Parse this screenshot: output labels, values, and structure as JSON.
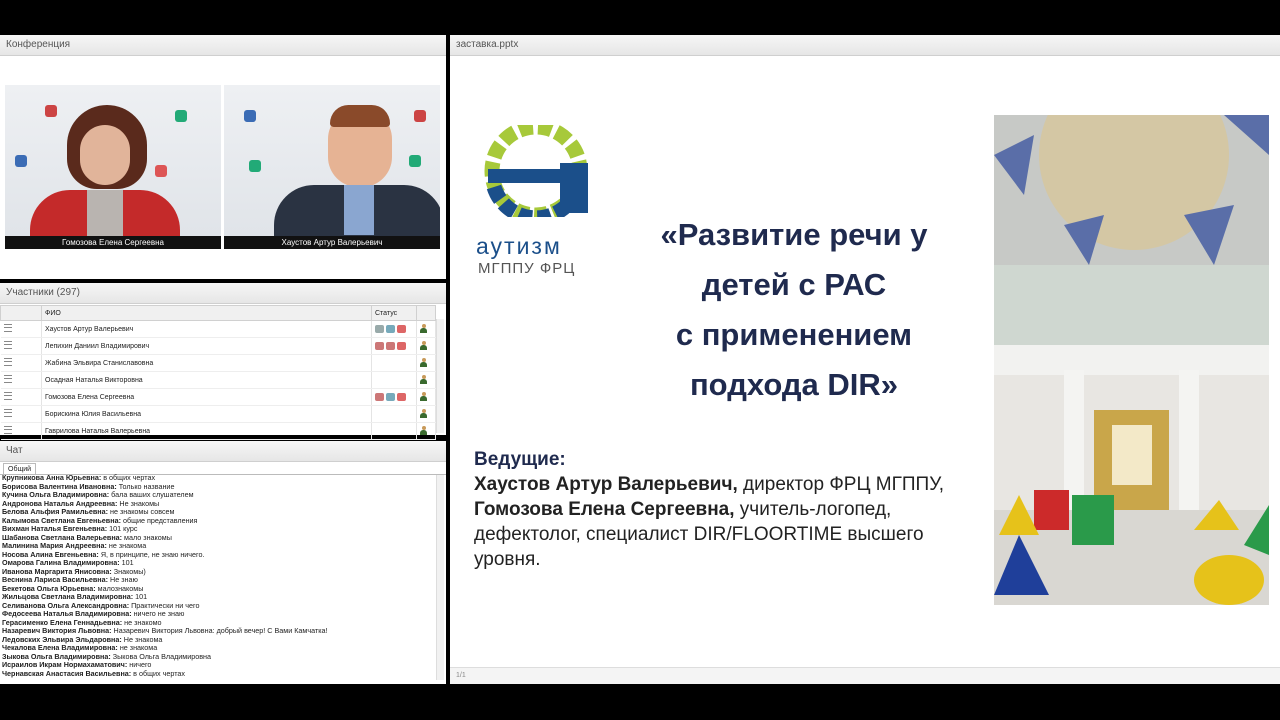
{
  "conference": {
    "title": "Конференция",
    "videos": [
      {
        "name": "Гомозова Елена Сергеевна"
      },
      {
        "name": "Хаустов Артур Валерьевич"
      }
    ]
  },
  "participants": {
    "title": "Участники (297)",
    "headers": {
      "name": "ФИО",
      "status": "Статус"
    },
    "rows": [
      {
        "name": "Хаустов Артур Валерьевич"
      },
      {
        "name": "Лепихин Даниил Владимирович"
      },
      {
        "name": "Жабина Эльвира Станиславовна"
      },
      {
        "name": "Осадная Наталья Викторовна"
      },
      {
        "name": "Гомозова Елена Сергеевна"
      },
      {
        "name": "Борискина Юлия Васильевна"
      },
      {
        "name": "Гаврилова Наталья Валерьевна"
      }
    ]
  },
  "chat": {
    "title": "Чат",
    "tab": "Общий",
    "messages": [
      {
        "author": "Крупникова Анна Юрьевна:",
        "text": " в общих чертах"
      },
      {
        "author": "Борисова Валентина Ивановна:",
        "text": " Только название"
      },
      {
        "author": "Кучина Ольга Владимировна:",
        "text": " бала ваших слушателем"
      },
      {
        "author": "Андронова Наталья Андреевна:",
        "text": " Не знакомы"
      },
      {
        "author": "Белова Альфия Рамильевна:",
        "text": " не знакомы совсем"
      },
      {
        "author": "Калымова Светлана Евгеньевна:",
        "text": " общие представления"
      },
      {
        "author": "Вихман Наталья  Евгеньевна:",
        "text": " 101 курс"
      },
      {
        "author": "Шабанова Светлана Валерьевна:",
        "text": " мало знакомы"
      },
      {
        "author": "Малинина Мария Андреевна:",
        "text": " не знакома"
      },
      {
        "author": "Носова Алина Евгеньевна:",
        "text": " Я, в принципе, не знаю ничего."
      },
      {
        "author": "Омарова Галина Владимировна:",
        "text": " 101"
      },
      {
        "author": "Иванова Маргарита Янисовна:",
        "text": " Знакомы)"
      },
      {
        "author": "Веснина Лариса Васильевна:",
        "text": " Не знаю"
      },
      {
        "author": "Бекетова Ольга Юрьевна:",
        "text": " малознакомы"
      },
      {
        "author": "Жильцова Светлана Владимировна:",
        "text": " 101"
      },
      {
        "author": "Селиванова Ольга Александровна:",
        "text": " Практически ни чего"
      },
      {
        "author": "Федосеева Наталья Владимировна:",
        "text": " ничего не знаю"
      },
      {
        "author": "Герасименко Елена Геннадьевна:",
        "text": " не знакомо"
      },
      {
        "author": "Назаревич Виктория Львовна:",
        "text": " Назаревич Виктория Львовна: добрый вечер! С Вами Камчатка!"
      },
      {
        "author": "Ледовских Эльвира Эльдаровна:",
        "text": " Не знакома"
      },
      {
        "author": "Чекалова Елена Владимировна:",
        "text": " не знакома"
      },
      {
        "author": "Зыкова Ольга Владимировна:",
        "text": " Зыкова Ольга Владимировна"
      },
      {
        "author": "Исраилов Икрам Нормахаматович:",
        "text": " ничего"
      },
      {
        "author": "Чернавская Анастасия Васильевна:",
        "text": " в общих чертах"
      }
    ]
  },
  "presentation": {
    "filename": "заставка.pptx",
    "page_indicator": "1/1",
    "slide": {
      "logo_word": "аутизм",
      "logo_sub": "МГППУ ФРЦ",
      "title_lines": [
        "«Развитие речи у",
        "детей с РАС",
        "с применением",
        "подхода DIR»"
      ],
      "hosts_label": "Ведущие:",
      "host1_name": "Хаустов Артур Валерьевич,",
      "host1_role": " директор ФРЦ МГППУ,",
      "host2_name": "Гомозова Елена Сергеевна,",
      "host2_role": " учитель-логопед, дефектолог, специалист DIR/FLOORTIME высшего уровня."
    },
    "colors": {
      "logo_green": "#a7c93a",
      "logo_blue": "#1b4f8a",
      "title": "#1f2a4e"
    }
  }
}
